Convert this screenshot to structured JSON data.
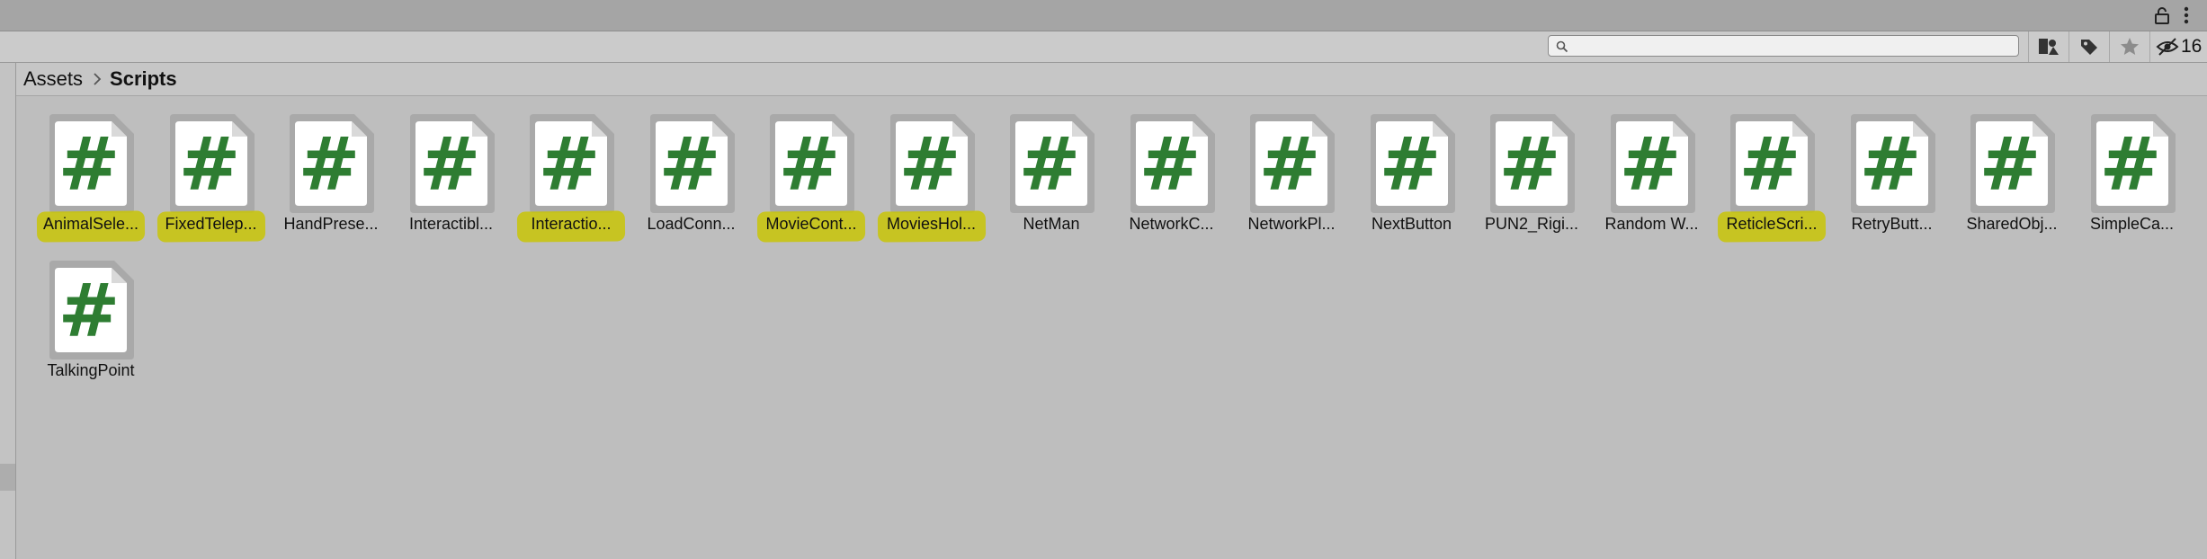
{
  "window": {
    "lock_icon": "lock-icon",
    "menu_icon": "kebab-menu-icon"
  },
  "toolbar": {
    "search_placeholder": "",
    "search_value": "",
    "buttons": [
      "search-by-type-icon",
      "search-by-label-icon",
      "favorites-star-icon"
    ],
    "hidden_packages_count": "16"
  },
  "breadcrumb": {
    "root": "Assets",
    "current": "Scripts"
  },
  "assets": [
    {
      "label": "AnimalSele...",
      "highlighted": true
    },
    {
      "label": "FixedTelep...",
      "highlighted": true
    },
    {
      "label": "HandPrese...",
      "highlighted": false
    },
    {
      "label": "Interactibl...",
      "highlighted": false
    },
    {
      "label": "Interactio...",
      "highlighted": true
    },
    {
      "label": "LoadConn...",
      "highlighted": false
    },
    {
      "label": "MovieCont...",
      "highlighted": true
    },
    {
      "label": "MoviesHol...",
      "highlighted": true
    },
    {
      "label": "NetMan",
      "highlighted": false
    },
    {
      "label": "NetworkC...",
      "highlighted": false
    },
    {
      "label": "NetworkPl...",
      "highlighted": false
    },
    {
      "label": "NextButton",
      "highlighted": false
    },
    {
      "label": "PUN2_Rigi...",
      "highlighted": false
    },
    {
      "label": "Random W...",
      "highlighted": false
    },
    {
      "label": "ReticleScri...",
      "highlighted": true
    },
    {
      "label": "RetryButt...",
      "highlighted": false
    },
    {
      "label": "SharedObj...",
      "highlighted": false
    },
    {
      "label": "SimpleCa...",
      "highlighted": false
    },
    {
      "label": "TalkingPoint",
      "highlighted": false
    }
  ],
  "colors": {
    "hash_green": "#2e7d32",
    "highlight": "#c9c600",
    "panel_bg": "#bebebe"
  }
}
